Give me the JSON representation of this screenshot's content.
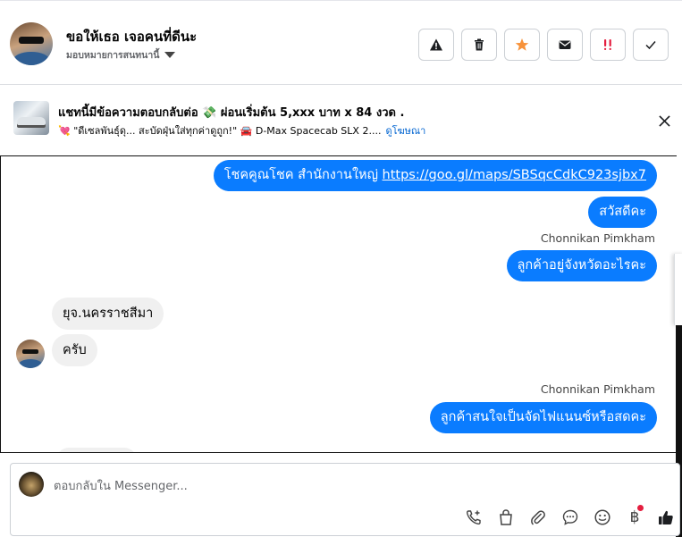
{
  "header": {
    "contact_name": "ขอให้เธอ เจอคนที่ดีนะ",
    "assign_label": "มอบหมายการสนทนานี้",
    "actions": [
      {
        "name": "report-spam",
        "icon": "warning-icon"
      },
      {
        "name": "delete",
        "icon": "trash-icon"
      },
      {
        "name": "star",
        "icon": "star-icon"
      },
      {
        "name": "mark-unread",
        "icon": "envelope-icon"
      },
      {
        "name": "follow-up",
        "icon": "exclamation-icon"
      },
      {
        "name": "mark-done",
        "icon": "check-icon"
      }
    ]
  },
  "ad_banner": {
    "title": "แชทนี้มีข้อความตอบกลับต่อ 💸 ผ่อนเริ่มต้น 5,xxx บาท x 84 งวด .",
    "subtitle_text": "💘 \"ดีเซลพันธุ์ดุ... สะบัดฝุ่นใส่ทุกค่าดูถูก!\" 🚘 D-Max Spacecab SLX 2....",
    "link_label": "ดูโฆษณา"
  },
  "messages": {
    "m1_prefix": "โชคคูณโชค สำนักงานใหญ่ ",
    "m1_link": "https://goo.gl/maps/SBSqcCdkC923sjbx7",
    "m2": "สวัสดีคะ",
    "sender1": "Chonnikan Pimkham",
    "m3": "ลูกค้าอยู่จังหวัดอะไรคะ",
    "m4": "ยุจ.นครราชสีมา",
    "m5": "ครับ",
    "sender2": "Chonnikan Pimkham",
    "m6": "ลูกค้าสนใจเป็นจัดไฟแนนซ์หรือสดคะ"
  },
  "composer": {
    "placeholder": "ตอบกลับใน Messenger...",
    "tools": [
      "phone-plus-icon",
      "shopping-bag-icon",
      "paperclip-icon",
      "chat-bubble-icon",
      "smiley-icon",
      "baht-icon",
      "thumbs-up-icon"
    ],
    "baht_symbol": "฿"
  },
  "colors": {
    "outgoing_bubble": "#0a7cff",
    "incoming_bubble": "#f0f0f0",
    "star": "#f7923a",
    "follow_up": "#e41e3f",
    "link": "#0064d1"
  }
}
